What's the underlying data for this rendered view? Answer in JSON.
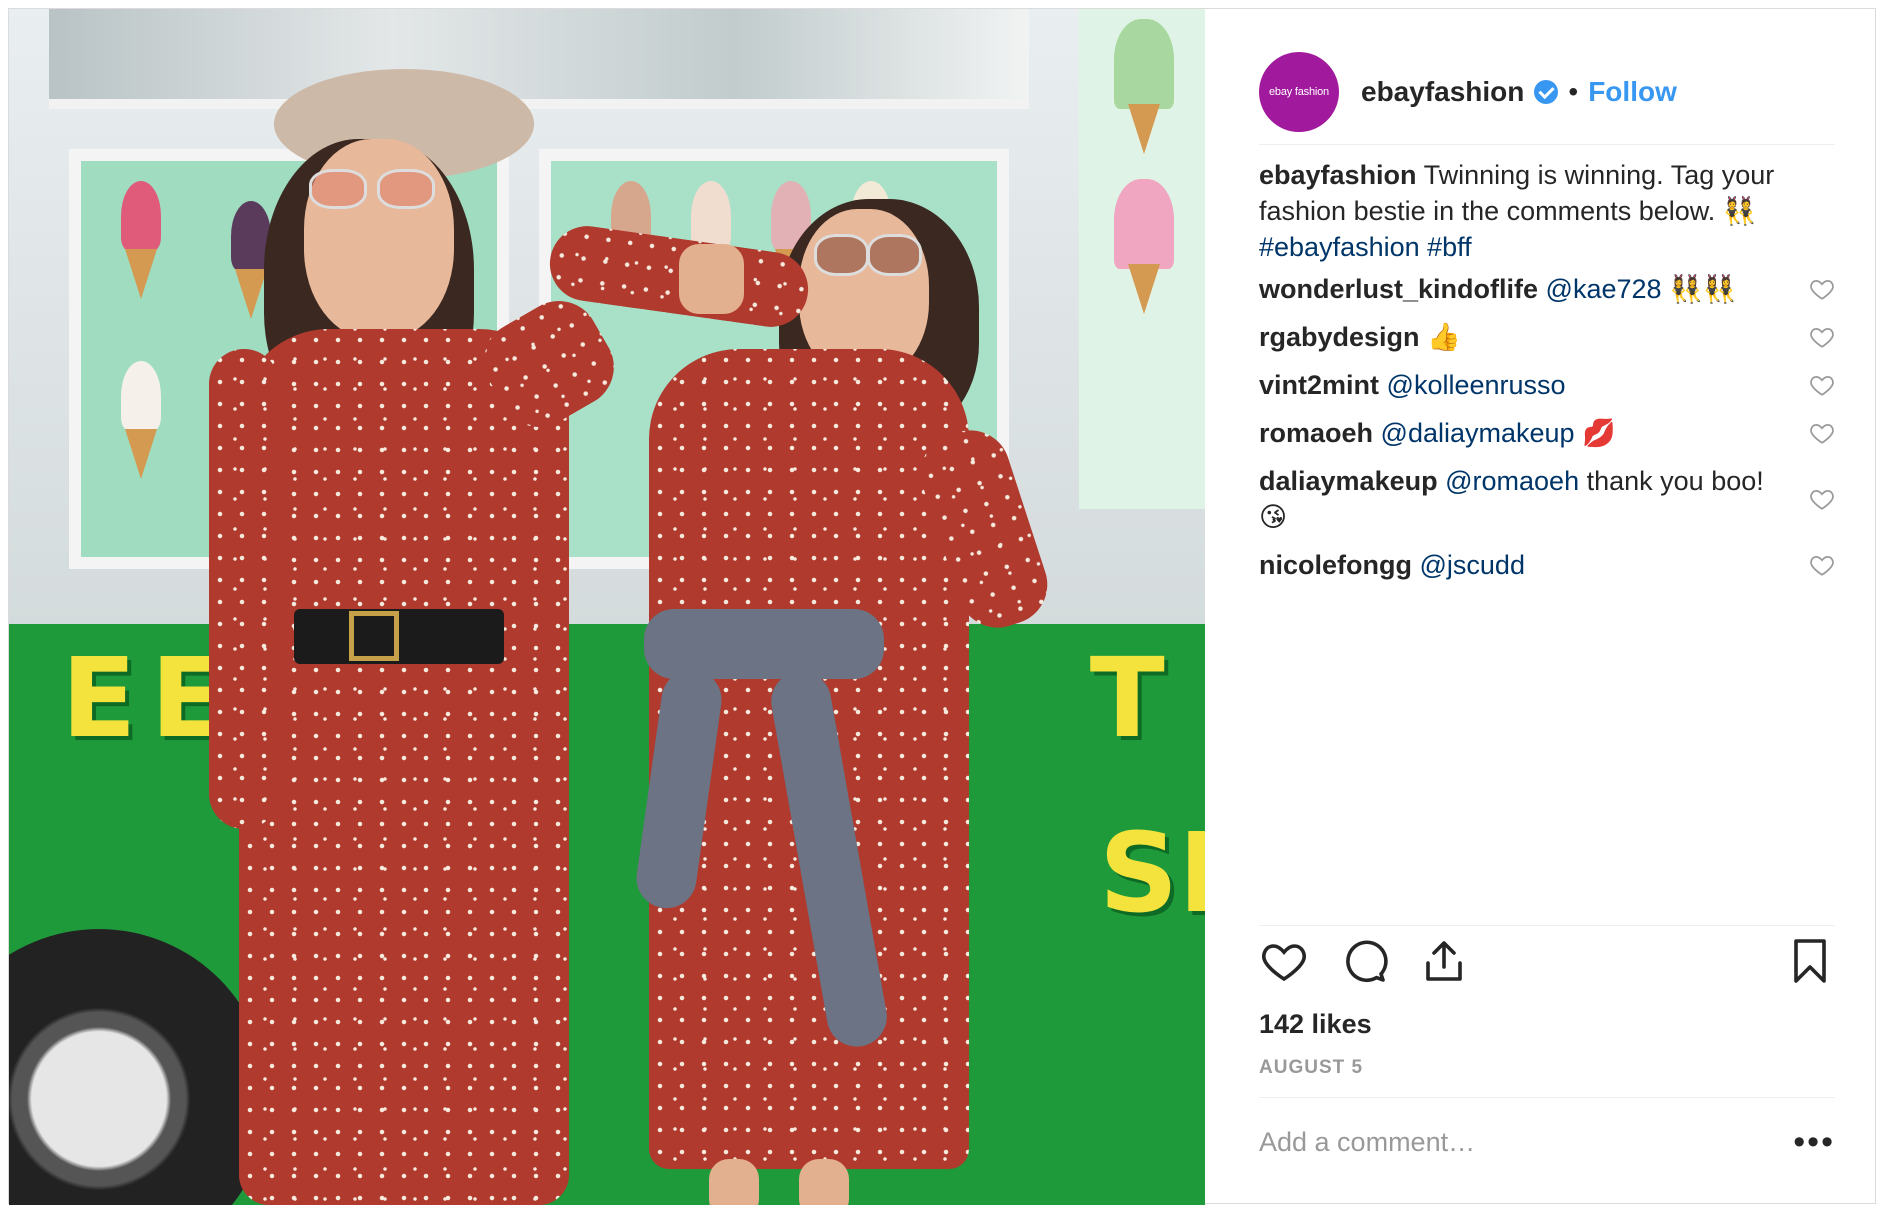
{
  "post": {
    "username": "ebayfashion",
    "avatar_text": "ebay fashion",
    "follow_label": "Follow",
    "separator": "•",
    "caption": {
      "username": "ebayfashion",
      "text": "Twinning is winning. Tag your fashion bestie in the comments below. 👯",
      "hashtags": "#ebayfashion #bff"
    },
    "comments": [
      {
        "username": "wonderlust_kindoflife",
        "mention": "@kae728",
        "text": "👯‍♀️👯‍♀️"
      },
      {
        "username": "rgabydesign",
        "mention": "",
        "text": "👍"
      },
      {
        "username": "vint2mint",
        "mention": "@kolleenrusso",
        "text": ""
      },
      {
        "username": "romaoeh",
        "mention": "@daliaymakeup",
        "text": "💋"
      },
      {
        "username": "daliaymakeup",
        "mention": "@romaoeh",
        "text": "thank you boo! 😘"
      },
      {
        "username": "nicolefongg",
        "mention": "@jscudd",
        "text": ""
      }
    ],
    "likes": "142 likes",
    "date": "AUGUST 5",
    "add_comment_placeholder": "Add a comment…",
    "more_label": "•••"
  },
  "icons": {
    "verified": "verified-badge-icon",
    "like": "heart-icon",
    "comment": "comment-bubble-icon",
    "share": "share-icon",
    "save": "bookmark-icon",
    "more": "more-options-icon"
  },
  "colors": {
    "link_blue": "#3897f0",
    "mention_blue": "#003569",
    "avatar_bg": "#a1199d",
    "text": "#262626",
    "muted": "#999999"
  }
}
